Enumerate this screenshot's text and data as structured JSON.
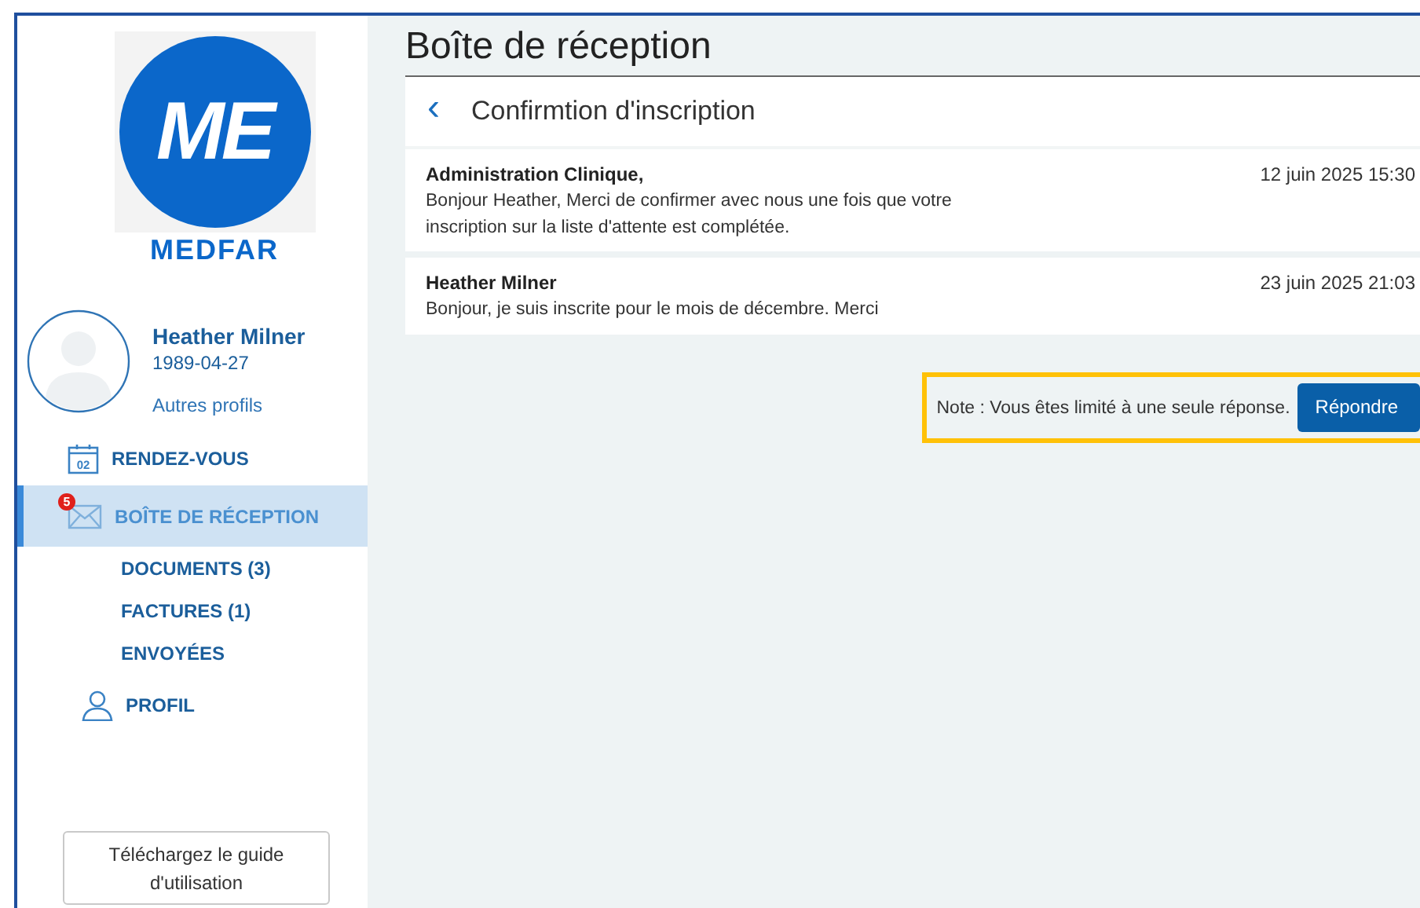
{
  "sidebar": {
    "logo": {
      "mark": "ME",
      "brand": "MEDFAR"
    },
    "profile": {
      "name": "Heather Milner",
      "birthdate": "1989-04-27",
      "other_profiles": "Autres profils"
    },
    "nav": [
      {
        "kind": "calendar",
        "label": "RENDEZ-VOUS",
        "icon_text": "02",
        "selected": false
      },
      {
        "kind": "mail",
        "label": "BOÎTE DE RÉCEPTION",
        "badge": "5",
        "selected": true,
        "children": [
          {
            "label": "DOCUMENTS (3)",
            "selected": false
          },
          {
            "label": "FACTURES (1)",
            "selected": false
          },
          {
            "label": "ENVOYÉES",
            "selected": false
          }
        ]
      },
      {
        "kind": "person",
        "label": "PROFIL",
        "selected": false
      }
    ],
    "guide_button": "Téléchargez le guide d'utilisation"
  },
  "main": {
    "title": "Boîte de réception",
    "thread": {
      "back": "‹",
      "subject": "Confirmtion d'inscription",
      "messages": [
        {
          "sender": "Administration Clinique,",
          "date": "12 juin 2025 15:30",
          "body": "Bonjour Heather, Merci de confirmer avec nous une fois que votre inscription sur la liste d'attente est complétée."
        },
        {
          "sender": "Heather Milner",
          "date": "23 juin 2025 21:03",
          "body": "Bonjour, je suis inscrite pour le mois de décembre. Merci"
        }
      ]
    },
    "note": "Note : Vous êtes limité à une seule réponse.",
    "reply_button": "Répondre"
  }
}
